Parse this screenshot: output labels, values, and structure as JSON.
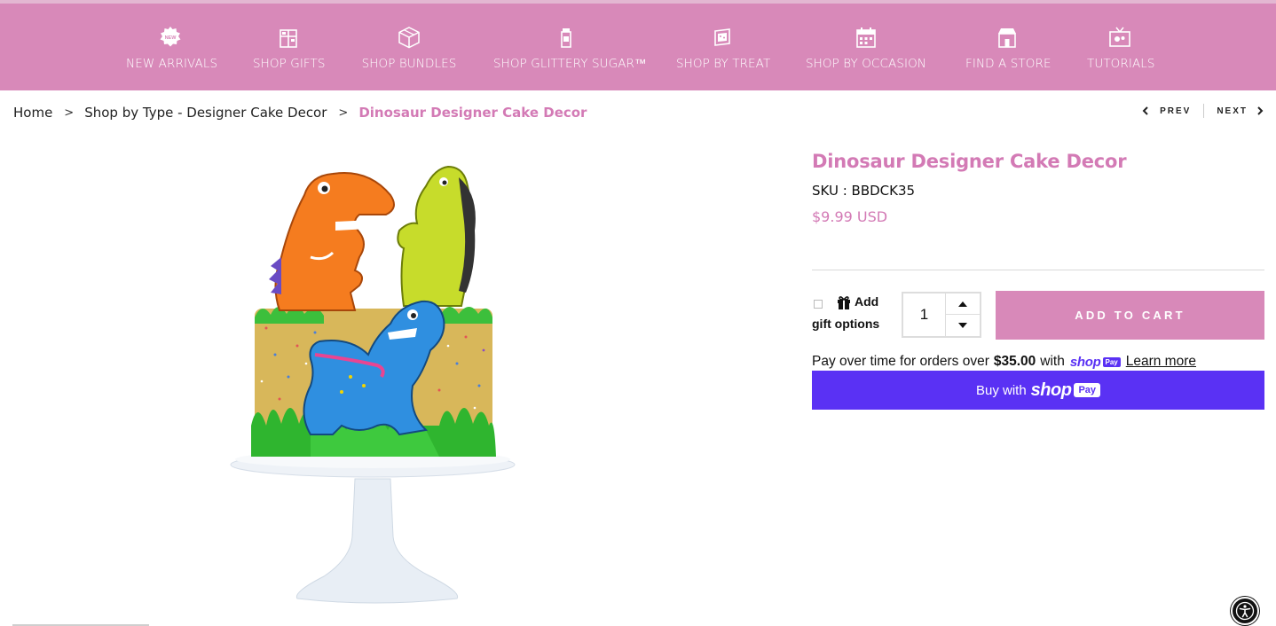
{
  "colors": {
    "nav_bg": "#d889b9",
    "brand_pink": "#d37ab5",
    "shop_pay_purple": "#5a31f4"
  },
  "nav": {
    "items": [
      {
        "label": "NEW ARRIVALS",
        "icon": "new-badge-icon"
      },
      {
        "label": "SHOP GIFTS",
        "icon": "gift-box-icon"
      },
      {
        "label": "SHOP BUNDLES",
        "icon": "bundle-box-icon"
      },
      {
        "label": "SHOP GLITTERY SUGAR™",
        "icon": "sugar-jar-icon"
      },
      {
        "label": "SHOP BY TREAT",
        "icon": "treat-box-icon"
      },
      {
        "label": "SHOP BY OCCASION",
        "icon": "calendar-icon"
      },
      {
        "label": "FIND A STORE",
        "icon": "store-icon"
      },
      {
        "label": "TUTORIALS",
        "icon": "tv-icon"
      }
    ]
  },
  "breadcrumb": {
    "items": [
      "Home",
      "Shop by Type - Designer Cake Decor"
    ],
    "current": "Dinosaur Designer Cake Decor",
    "separator": ">"
  },
  "pager": {
    "prev": "PREV",
    "next": "NEXT"
  },
  "product": {
    "title": "Dinosaur Designer Cake Decor",
    "sku_label": "SKU : BBDCK35",
    "price": "$9.99 USD",
    "gift_option_line1": "Add",
    "gift_option_line2": "gift options",
    "quantity": "1",
    "add_to_cart": "ADD TO CART"
  },
  "shop_pay": {
    "pay_text": "Pay over time for orders over",
    "threshold": "$35.00",
    "with": "with",
    "brand_word": "shop",
    "pay_badge": "Pay",
    "learn_more": "Learn more",
    "buy_text": "Buy with"
  }
}
